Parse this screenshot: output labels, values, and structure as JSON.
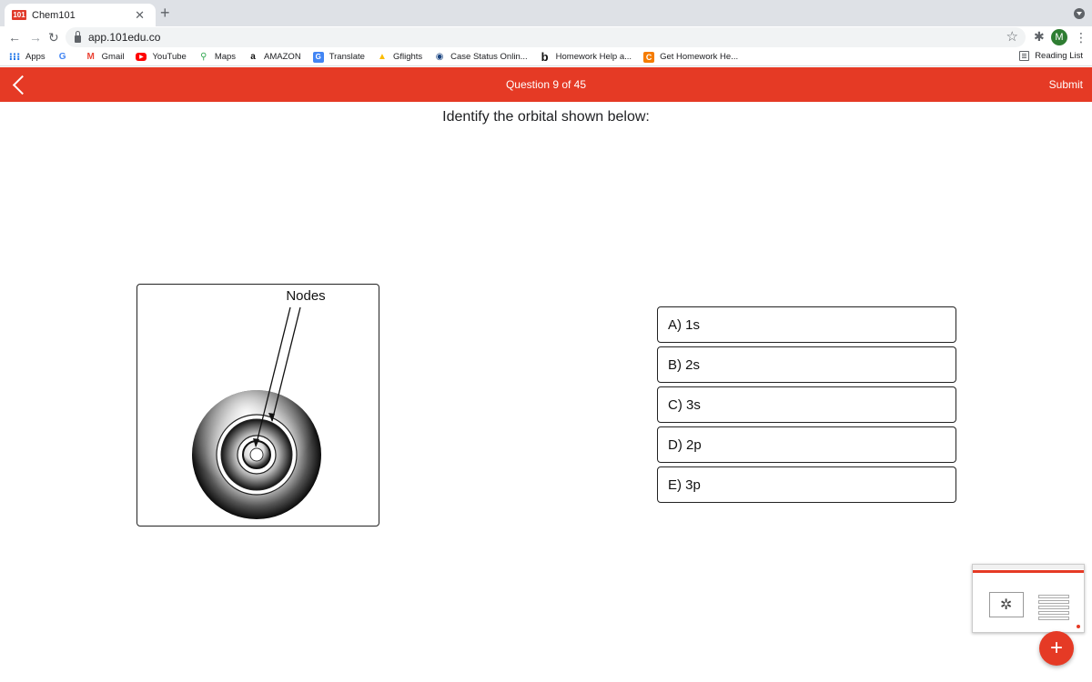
{
  "browser": {
    "tab_title": "Chem101",
    "tab_favicon_text": "101",
    "url": "app.101edu.co",
    "avatar_initial": "M",
    "bookmarks": [
      {
        "label": "Apps",
        "icon": "apps-grid-icon"
      },
      {
        "label": "",
        "icon": "google-icon"
      },
      {
        "label": "Gmail",
        "icon": "gmail-icon"
      },
      {
        "label": "YouTube",
        "icon": "youtube-icon"
      },
      {
        "label": "Maps",
        "icon": "maps-icon"
      },
      {
        "label": "AMAZON",
        "icon": "amazon-icon"
      },
      {
        "label": "Translate",
        "icon": "translate-icon"
      },
      {
        "label": "Gflights",
        "icon": "gflights-icon"
      },
      {
        "label": "Case Status Onlin...",
        "icon": "uscis-icon"
      },
      {
        "label": "Homework Help a...",
        "icon": "bartleby-icon"
      },
      {
        "label": "Get Homework He...",
        "icon": "chegg-icon"
      }
    ],
    "reading_list_label": "Reading List"
  },
  "app": {
    "header_color": "#e53a25",
    "question_counter": "Question 9 of 45",
    "submit_label": "Submit",
    "question_text": "Identify the orbital shown below:",
    "figure_label": "Nodes",
    "answers": [
      {
        "label": "A) 1s"
      },
      {
        "label": "B) 2s"
      },
      {
        "label": "C) 3s"
      },
      {
        "label": "D) 2p"
      },
      {
        "label": "E) 3p"
      }
    ],
    "fab_label": "+"
  }
}
